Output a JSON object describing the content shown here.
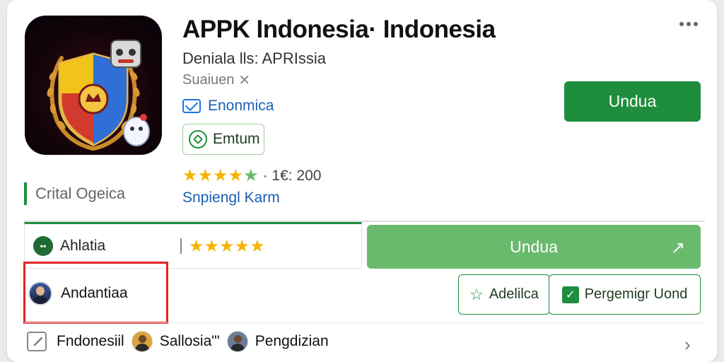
{
  "app": {
    "title": "APPK Indonesia· Indonesia",
    "developer": "Deniala lls: APRIssia",
    "secondary": "Suaiuen",
    "secondary_icon": "close-icon",
    "category": "Enonmica",
    "badge": "Emtum",
    "rating_value": "· 1€: 200",
    "rating_stars": "★★★★",
    "rating_star_last": "★",
    "link": "Snpiengl Karm",
    "official_label": "Crital Ogeica"
  },
  "actions": {
    "install_top": "Undua",
    "install_wide": "Undua"
  },
  "tab": {
    "icon_text": "••",
    "label": "Ahlatia",
    "stars": "★★★★★"
  },
  "user": {
    "name": "Andantiaa"
  },
  "buttons": {
    "wishlist": "Adelilca",
    "permission": "Pergemigr Uond"
  },
  "bottom": {
    "item1": "Fndonesiil",
    "item2": "Sallosia\"'",
    "item3": "Pengdizian"
  },
  "colors": {
    "primary_green": "#1e8e3e",
    "light_green": "#6aba6e",
    "link_blue": "#1a5fb4",
    "star_yellow": "#f5b400",
    "highlight_red": "#e02424"
  }
}
